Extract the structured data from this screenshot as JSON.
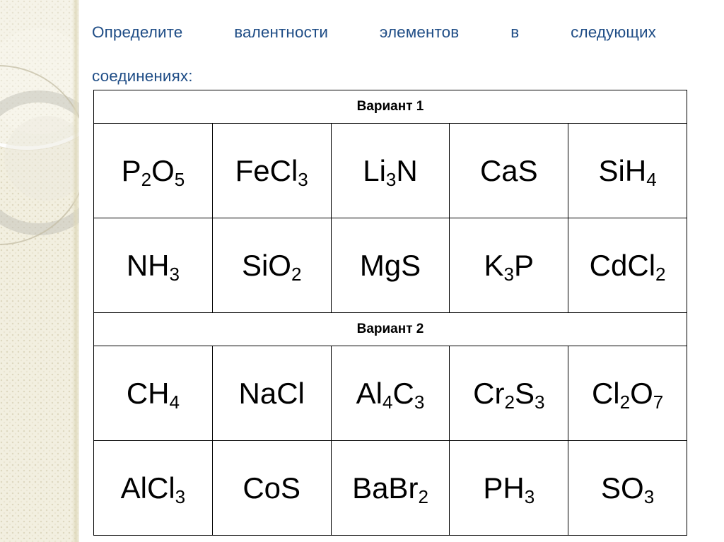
{
  "slide": {
    "title_line1": "Определите валентности элементов в следующих",
    "title_line2": "соединениях:",
    "title_color": "#1f4d86",
    "background_color": "#ffffff",
    "decoration_color": "#f2efe0"
  },
  "table": {
    "sections": [
      {
        "header": "Вариант 1",
        "rows": [
          [
            {
              "formula": "P2O5",
              "parts": [
                {
                  "t": "P"
                },
                {
                  "s": "2"
                },
                {
                  "t": "O"
                },
                {
                  "s": "5"
                }
              ]
            },
            {
              "formula": "FeCl3",
              "parts": [
                {
                  "t": "FeCl"
                },
                {
                  "s": "3"
                }
              ]
            },
            {
              "formula": "Li3N",
              "parts": [
                {
                  "t": "Li"
                },
                {
                  "s": "3"
                },
                {
                  "t": "N"
                }
              ]
            },
            {
              "formula": "CaS",
              "parts": [
                {
                  "t": "CaS"
                }
              ]
            },
            {
              "formula": "SiH4",
              "parts": [
                {
                  "t": "SiH"
                },
                {
                  "s": "4"
                }
              ]
            }
          ],
          [
            {
              "formula": "NH3",
              "parts": [
                {
                  "t": "NH"
                },
                {
                  "s": "3"
                }
              ]
            },
            {
              "formula": "SiO2",
              "parts": [
                {
                  "t": "SiO"
                },
                {
                  "s": "2"
                }
              ]
            },
            {
              "formula": "MgS",
              "parts": [
                {
                  "t": "MgS"
                }
              ]
            },
            {
              "formula": "K3P",
              "parts": [
                {
                  "t": "K"
                },
                {
                  "s": "3"
                },
                {
                  "t": "P"
                }
              ]
            },
            {
              "formula": "CdCl2",
              "parts": [
                {
                  "t": "CdCl"
                },
                {
                  "s": "2"
                }
              ]
            }
          ]
        ]
      },
      {
        "header": "Вариант 2",
        "rows": [
          [
            {
              "formula": "CH4",
              "parts": [
                {
                  "t": "CH"
                },
                {
                  "s": "4"
                }
              ]
            },
            {
              "formula": "NaCl",
              "parts": [
                {
                  "t": "NaCl"
                }
              ]
            },
            {
              "formula": "Al4C3",
              "parts": [
                {
                  "t": "Al"
                },
                {
                  "s": "4"
                },
                {
                  "t": "C"
                },
                {
                  "s": "3"
                }
              ]
            },
            {
              "formula": "Cr2S3",
              "parts": [
                {
                  "t": "Cr"
                },
                {
                  "s": "2"
                },
                {
                  "t": "S"
                },
                {
                  "s": "3"
                }
              ]
            },
            {
              "formula": "Cl2O7",
              "parts": [
                {
                  "t": "Cl"
                },
                {
                  "s": "2"
                },
                {
                  "t": "O"
                },
                {
                  "s": "7"
                }
              ]
            }
          ],
          [
            {
              "formula": "AlCl3",
              "parts": [
                {
                  "t": "AlCl"
                },
                {
                  "s": "3"
                }
              ]
            },
            {
              "formula": "CoS",
              "parts": [
                {
                  "t": "CoS"
                }
              ]
            },
            {
              "formula": "BaBr2",
              "parts": [
                {
                  "t": "BaBr"
                },
                {
                  "s": "2"
                }
              ]
            },
            {
              "formula": "PH3",
              "parts": [
                {
                  "t": "PH"
                },
                {
                  "s": "3"
                }
              ]
            },
            {
              "formula": "SO3",
              "parts": [
                {
                  "t": "SO"
                },
                {
                  "s": "3"
                }
              ]
            }
          ]
        ]
      }
    ],
    "column_count": 5
  }
}
